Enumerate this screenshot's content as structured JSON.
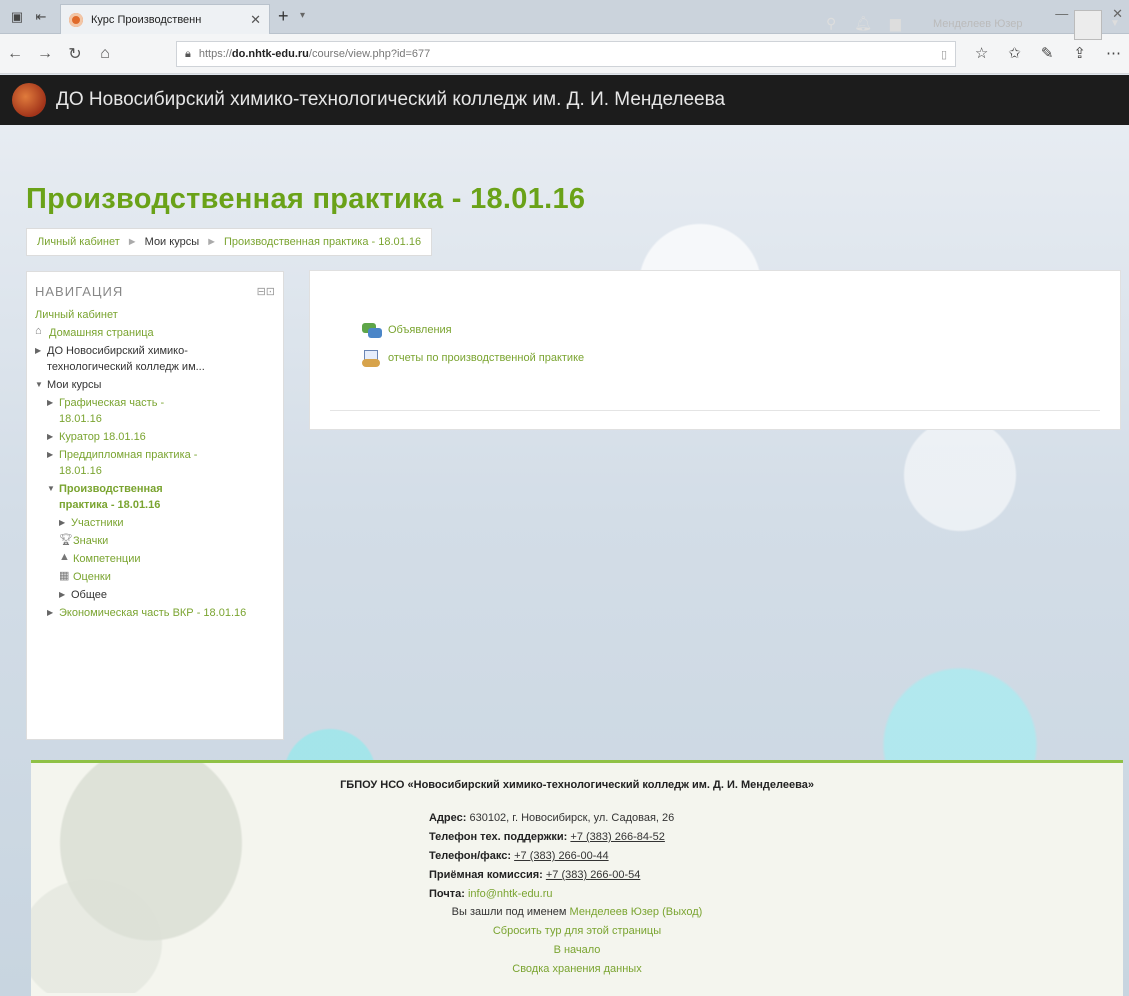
{
  "browser": {
    "tab_title": "Курс Производственн",
    "url_prefix": "https://",
    "url_host": "do.nhtk-edu.ru",
    "url_path": "/course/view.php?id=677"
  },
  "site": {
    "name": "ДО Новосибирский химико-технологический колледж им. Д. И. Менделеева",
    "user_name": "Менделеев Юзер"
  },
  "page": {
    "title": "Производственная практика - 18.01.16",
    "breadcrumb": {
      "dashboard": "Личный кабинет",
      "my_courses": "Мои курсы",
      "current": "Производственная практика - 18.01.16"
    }
  },
  "navigation": {
    "title": "НАВИГАЦИЯ",
    "dashboard": "Личный кабинет",
    "home": "Домашняя страница",
    "site": "ДО Новосибирский химико-технологический колледж им...",
    "my_courses": "Мои курсы",
    "courses": {
      "c1": "Графическая часть - 18.01.16",
      "c2": "Куратор 18.01.16",
      "c3": "Преддипломная практика - 18.01.16",
      "c4": "Производственная практика - 18.01.16",
      "c5": "Экономическая часть ВКР - 18.01.16"
    },
    "current_course_items": {
      "participants": "Участники",
      "badges": "Значки",
      "competencies": "Компетенции",
      "grades": "Оценки",
      "general": "Общее"
    }
  },
  "content": {
    "activities": {
      "forum": "Объявления",
      "assignment": "отчеты по производственной практике"
    }
  },
  "footer": {
    "org": "ГБПОУ НСО «Новосибирский химико-технологический колледж им. Д. И. Менделеева»",
    "address_label": "Адрес:",
    "address": "630102, г. Новосибирск, ул. Садовая, 26",
    "support_label": "Телефон тех. поддержки:",
    "support_phone": "+7 (383) 266-84-52",
    "phone_fax_label": "Телефон/факс:",
    "phone_fax": "+7 (383) 266-00-44",
    "admission_label": "Приёмная комиссия:",
    "admission_phone": "+7 (383) 266-00-54",
    "mail_label": "Почта:",
    "mail": "info@nhtk-edu.ru",
    "logged_in_prefix": "Вы зашли под именем",
    "logged_in_user": "Менделеев Юзер",
    "logout": "(Выход)",
    "reset_tour": "Сбросить тур для этой страницы",
    "home_link": "В начало",
    "data_retention": "Сводка хранения данных"
  }
}
